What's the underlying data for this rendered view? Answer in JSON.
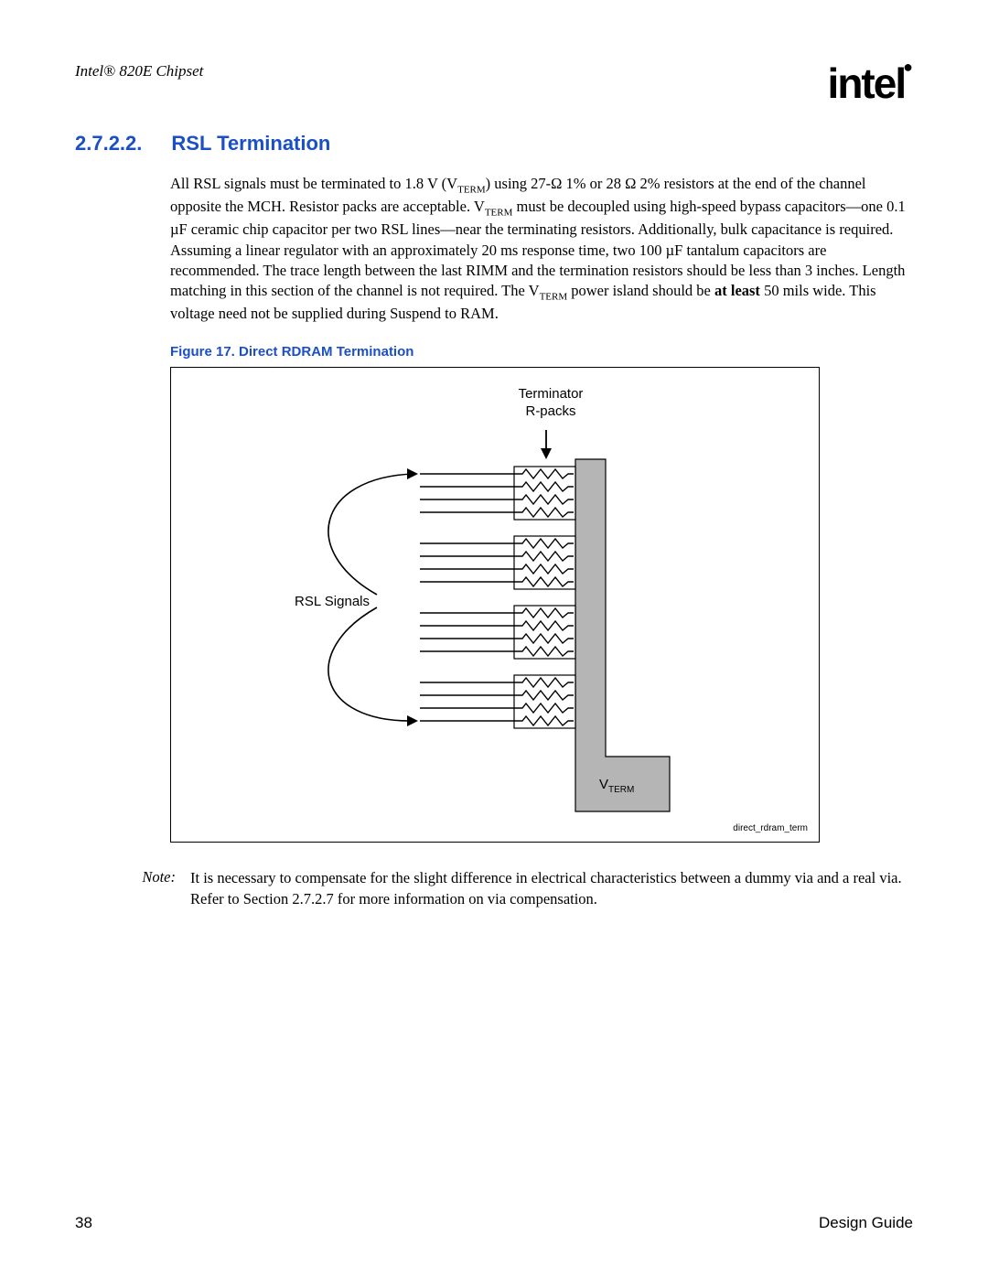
{
  "header": {
    "doc_title": "Intel® 820E Chipset",
    "logo_text": "intel"
  },
  "section": {
    "number": "2.7.2.2.",
    "title": "RSL Termination"
  },
  "paragraph": {
    "p1a": "All RSL signals must be terminated to 1.8 V (V",
    "p1b": ") using 27-Ω 1% or 28 Ω 2% resistors at the end of the channel opposite the MCH. Resistor packs are acceptable. V",
    "p1c": " must be decoupled using high-speed bypass capacitors—one 0.1 µF ceramic chip capacitor per two RSL lines—near the terminating resistors. Additionally, bulk capacitance is required. Assuming a linear regulator with an approximately 20 ms response time, two 100 µF tantalum capacitors are recommended. The trace length between the last RIMM and the termination resistors should be less than 3 inches. Length matching in this section of the channel is not required. The V",
    "p1d": " power island should be ",
    "p1e": "at least",
    "p1f": " 50 mils wide. This voltage need not be supplied during Suspend to RAM.",
    "sub_term": "TERM"
  },
  "figure": {
    "caption": "Figure 17. Direct RDRAM Termination",
    "label_terminator_l1": "Terminator",
    "label_terminator_l2": "R-packs",
    "label_rsl": "RSL Signals",
    "label_vterm_prefix": "V",
    "label_vterm_sub": "TERM",
    "file_tag": "direct_rdram_term"
  },
  "note": {
    "label": "Note:",
    "text": "It is necessary to compensate for the slight difference in electrical characteristics between a dummy via and a real via. Refer to Section 2.7.2.7 for more information on via compensation."
  },
  "footer": {
    "page": "38",
    "doc": "Design Guide"
  }
}
